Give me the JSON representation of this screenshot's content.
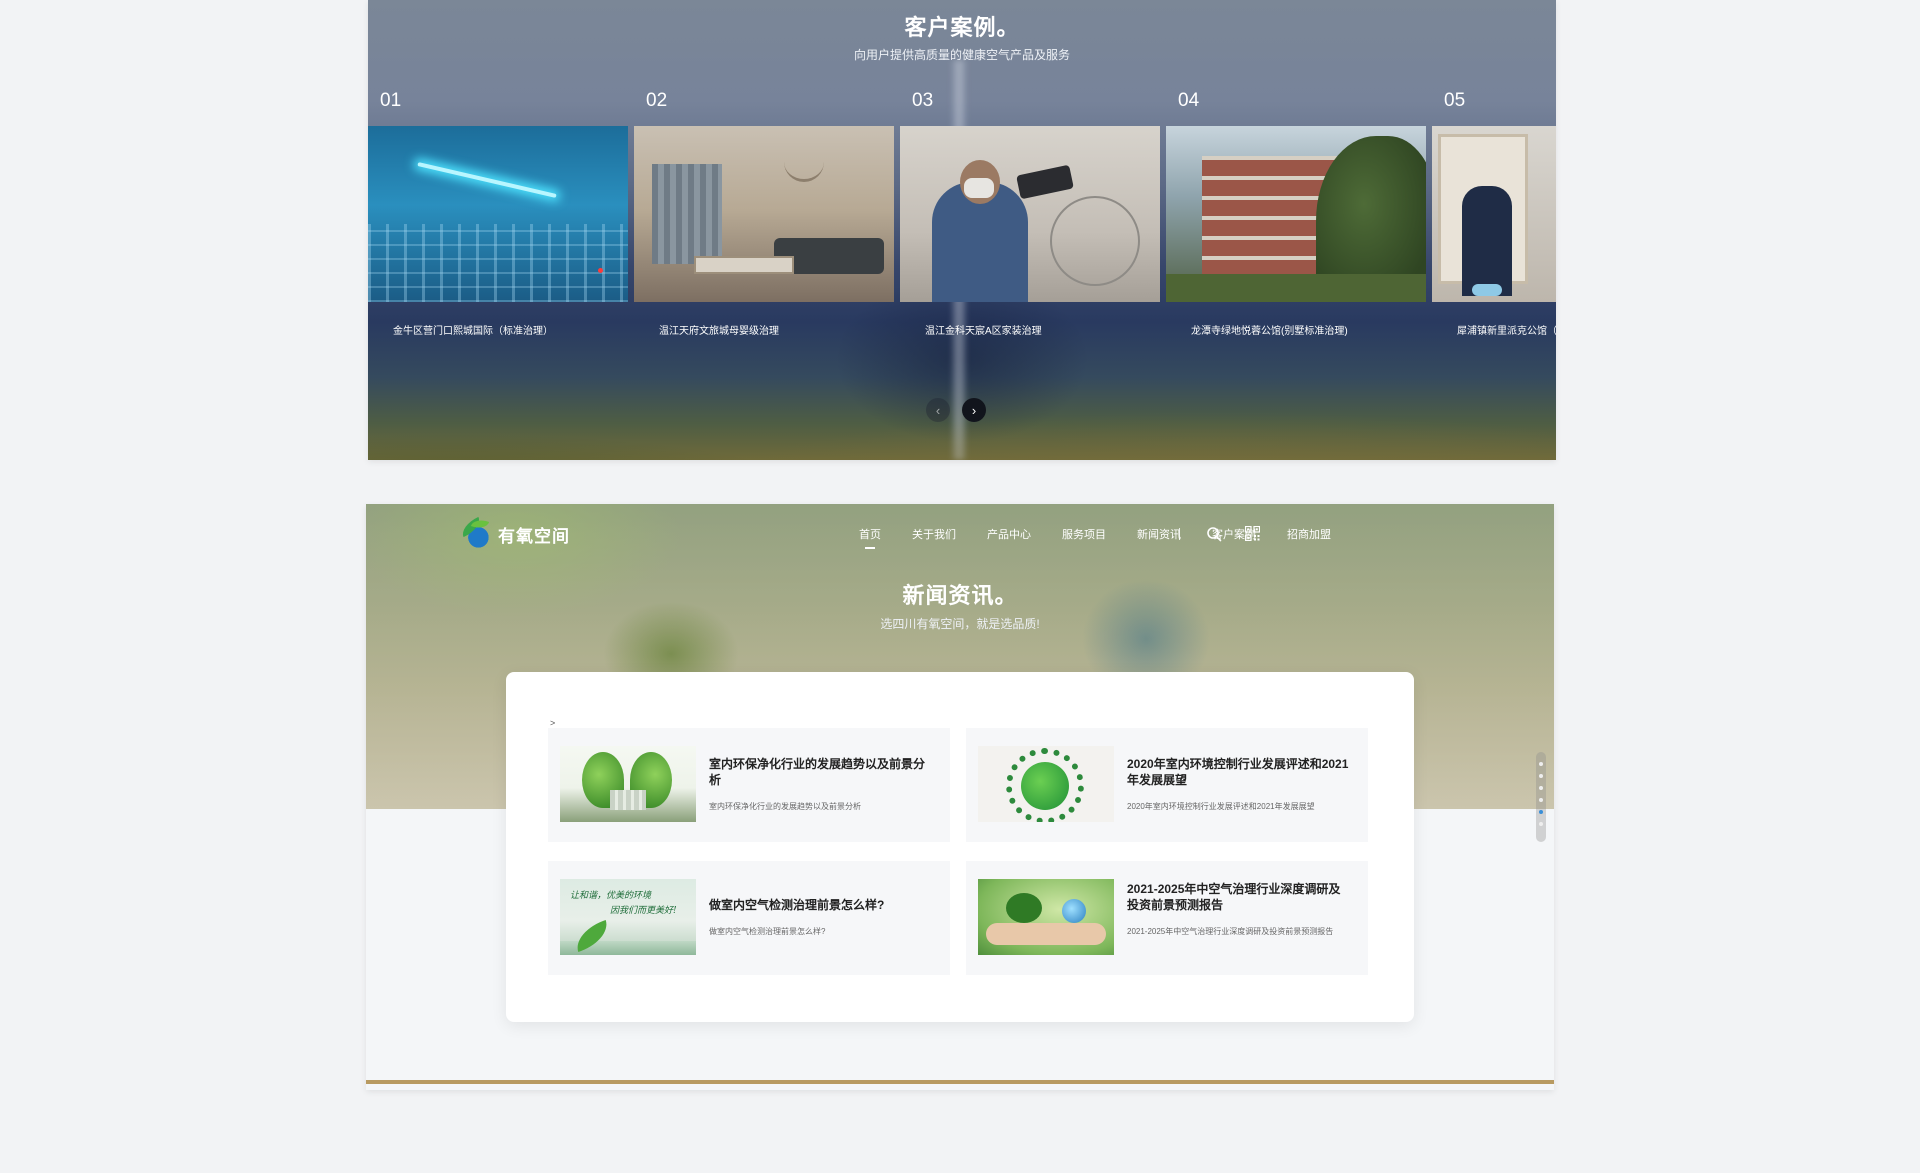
{
  "cases": {
    "title": "客户案例。",
    "subtitle": "向用户提供高质量的健康空气产品及服务",
    "items": [
      {
        "num": "01",
        "caption": "金牛区营门口熙城国际（标准治理）"
      },
      {
        "num": "02",
        "caption": "温江天府文旅城母婴级治理"
      },
      {
        "num": "03",
        "caption": "温江金科天宸A区家装治理"
      },
      {
        "num": "04",
        "caption": "龙潭寺绿地悦蓉公馆(别墅标准治理)"
      },
      {
        "num": "05",
        "caption": "犀浦镇新里派克公馆（"
      }
    ],
    "pager": {
      "prev": "‹",
      "next": "›"
    }
  },
  "nav": {
    "logo_text": "有氧空间",
    "items": [
      "首页",
      "关于我们",
      "产品中心",
      "服务项目",
      "新闻资讯",
      "客户案例",
      "招商加盟"
    ],
    "active_index": 0
  },
  "news": {
    "title": "新闻资讯。",
    "subtitle": "选四川有氧空间，就是选品质!",
    "breadcrumb": ">",
    "items": [
      {
        "title": "室内环保净化行业的发展趋势以及前景分析",
        "desc": "室内环保净化行业的发展趋势以及前景分析"
      },
      {
        "title": "2020年室内环境控制行业发展评述和2021年发展展望",
        "desc": "2020年室内环境控制行业发展评述和2021年发展展望"
      },
      {
        "title": "做室内空气检测治理前景怎么样?",
        "desc": "做室内空气检测治理前景怎么样?"
      },
      {
        "title": "2021-2025年中空气治理行业深度调研及投资前景预测报告",
        "desc": "2021-2025年中空气治理行业深度调研及投资前景预测报告"
      }
    ],
    "thumb3_text": [
      "让和谐，优美的环境",
      "因我们而更美好!"
    ]
  },
  "icons": {
    "search": "search-icon",
    "qr": "qr-code-icon",
    "prev": "chevron-left-icon",
    "next": "chevron-right-icon"
  },
  "colors": {
    "accent_gold": "#b89a61",
    "scroll_active": "#3a8fd8"
  }
}
